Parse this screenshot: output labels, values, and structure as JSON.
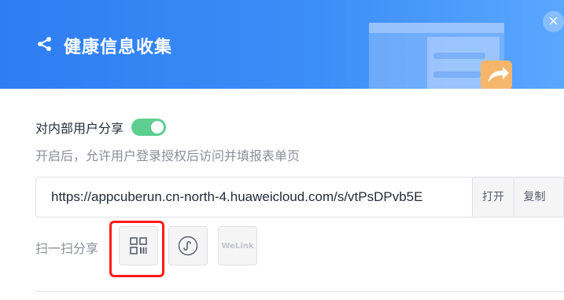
{
  "header": {
    "title": "健康信息收集",
    "icons": {
      "share": "share-icon",
      "close": "close-icon"
    },
    "close_glyph": "×",
    "bg_color": "#3b8df7"
  },
  "internal_share": {
    "label": "对内部用户分享",
    "toggle_on": true,
    "toggle_color": "#5ecf91",
    "hint": "开启后，允许用户登录授权后访问并填报表单页"
  },
  "link": {
    "url": "https://appcuberun.cn-north-4.huaweicloud.com/s/vtPsDPvb5E",
    "open_label": "打开",
    "copy_label": "复制"
  },
  "scan_share": {
    "label": "扫一扫分享",
    "buttons": [
      {
        "icon": "qr-code-icon",
        "highlighted": true
      },
      {
        "icon": "mini-program-icon"
      },
      {
        "icon": "welink-icon",
        "text": "WeLink"
      }
    ],
    "highlight_color": "#ff1a1a"
  }
}
